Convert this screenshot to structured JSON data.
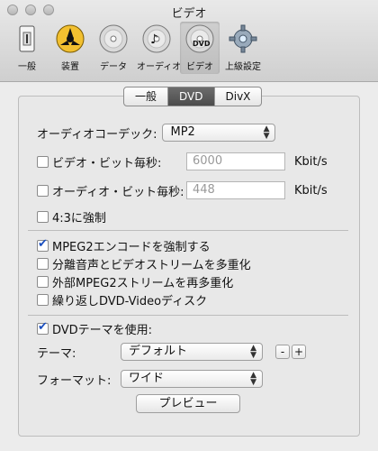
{
  "window": {
    "title": "ビデオ"
  },
  "toolbar": {
    "items": [
      {
        "label": "一般",
        "icon": "general-icon"
      },
      {
        "label": "装置",
        "icon": "device-icon"
      },
      {
        "label": "データ",
        "icon": "data-icon"
      },
      {
        "label": "オーディオ",
        "icon": "audio-icon"
      },
      {
        "label": "ビデオ",
        "icon": "video-icon"
      },
      {
        "label": "上級設定",
        "icon": "advanced-icon"
      }
    ],
    "dvd_disc_text": "DVD"
  },
  "tabs": [
    "一般",
    "DVD",
    "DivX"
  ],
  "form": {
    "audio_codec_label": "オーディオコーデック:",
    "audio_codec_value": "MP2",
    "video_bitrate_label": "ビデオ・ビット毎秒:",
    "video_bitrate_value": "6000",
    "video_bitrate_unit": "Kbit/s",
    "audio_bitrate_label": "オーディオ・ビット毎秒:",
    "audio_bitrate_value": "448",
    "audio_bitrate_unit": "Kbit/s",
    "force_43_label": "4:3に強制",
    "force_mpeg2_label": "MPEG2エンコードを強制する",
    "mux_label": "分離音声とビデオストリームを多重化",
    "remux_label": "外部MPEG2ストリームを再多重化",
    "loop_label": "繰り返しDVD-Videoディスク",
    "use_theme_label": "DVDテーマを使用:",
    "theme_label": "テーマ:",
    "theme_value": "デフォルト",
    "theme_minus": "-",
    "theme_plus": "+",
    "format_label": "フォーマット:",
    "format_value": "ワイド",
    "preview_button": "プレビュー"
  }
}
